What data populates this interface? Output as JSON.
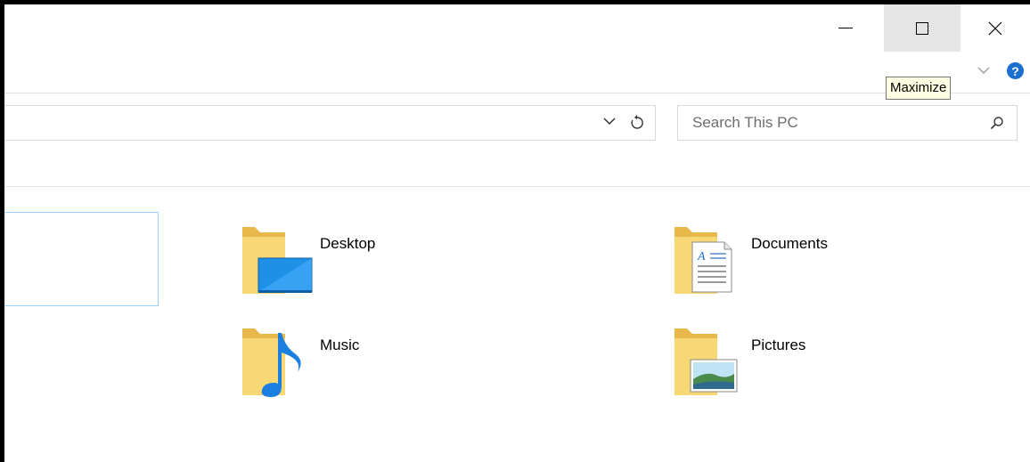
{
  "window": {
    "tooltip": "Maximize",
    "caption_icons": [
      "minimize-icon",
      "maximize-icon",
      "close-icon"
    ]
  },
  "ribbon": {
    "icons": [
      "chevron-down-icon",
      "help-icon"
    ],
    "help_label": "?"
  },
  "address": {
    "icons": [
      "chevron-down-icon",
      "refresh-icon"
    ]
  },
  "search": {
    "placeholder": "Search This PC",
    "icon": "search-icon"
  },
  "folders": [
    {
      "label": "Desktop",
      "icon": "desktop-folder-icon"
    },
    {
      "label": "Documents",
      "icon": "documents-folder-icon"
    },
    {
      "label": "Music",
      "icon": "music-folder-icon"
    },
    {
      "label": "Pictures",
      "icon": "pictures-folder-icon"
    }
  ],
  "colors": {
    "accent": "#1a6fd0",
    "selection_border": "#99d1ff",
    "tooltip_bg": "#ffffe1",
    "hover_bg": "#e5e5e5",
    "folder": "#f8d775"
  }
}
